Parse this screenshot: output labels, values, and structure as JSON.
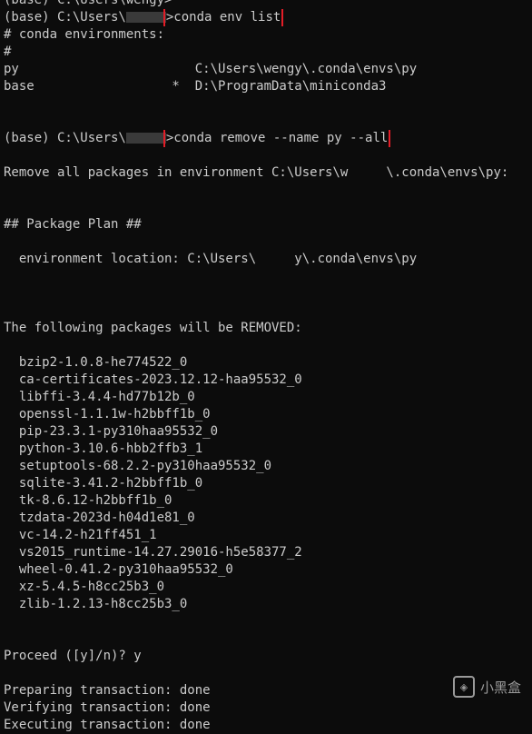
{
  "terminal": {
    "lines": [
      {
        "type": "text",
        "text": "(base) C:\\Users\\wengy>"
      },
      {
        "type": "prompt",
        "prefix": "(base) C:\\Users\\",
        "suffix": ">",
        "command": "conda env list",
        "boxed": true
      },
      {
        "type": "text",
        "text": "# conda environments:"
      },
      {
        "type": "text",
        "text": "#"
      },
      {
        "type": "text",
        "text": "py                       C:\\Users\\wengy\\.conda\\envs\\py"
      },
      {
        "type": "text",
        "text": "base                  *  D:\\ProgramData\\miniconda3"
      },
      {
        "type": "blank"
      },
      {
        "type": "blank"
      },
      {
        "type": "prompt",
        "prefix": "(base) C:\\Users\\",
        "suffix": ">",
        "command": "conda remove --name py --all",
        "boxed": true
      },
      {
        "type": "blank"
      },
      {
        "type": "text",
        "text": "Remove all packages in environment C:\\Users\\w     \\.conda\\envs\\py:"
      },
      {
        "type": "blank"
      },
      {
        "type": "blank"
      },
      {
        "type": "text",
        "text": "## Package Plan ##"
      },
      {
        "type": "blank"
      },
      {
        "type": "text",
        "text": "  environment location: C:\\Users\\     y\\.conda\\envs\\py"
      },
      {
        "type": "blank"
      },
      {
        "type": "blank"
      },
      {
        "type": "blank"
      },
      {
        "type": "text",
        "text": "The following packages will be REMOVED:"
      },
      {
        "type": "blank"
      },
      {
        "type": "text",
        "text": "  bzip2-1.0.8-he774522_0"
      },
      {
        "type": "text",
        "text": "  ca-certificates-2023.12.12-haa95532_0"
      },
      {
        "type": "text",
        "text": "  libffi-3.4.4-hd77b12b_0"
      },
      {
        "type": "text",
        "text": "  openssl-1.1.1w-h2bbff1b_0"
      },
      {
        "type": "text",
        "text": "  pip-23.3.1-py310haa95532_0"
      },
      {
        "type": "text",
        "text": "  python-3.10.6-hbb2ffb3_1"
      },
      {
        "type": "text",
        "text": "  setuptools-68.2.2-py310haa95532_0"
      },
      {
        "type": "text",
        "text": "  sqlite-3.41.2-h2bbff1b_0"
      },
      {
        "type": "text",
        "text": "  tk-8.6.12-h2bbff1b_0"
      },
      {
        "type": "text",
        "text": "  tzdata-2023d-h04d1e81_0"
      },
      {
        "type": "text",
        "text": "  vc-14.2-h21ff451_1"
      },
      {
        "type": "text",
        "text": "  vs2015_runtime-14.27.29016-h5e58377_2"
      },
      {
        "type": "text",
        "text": "  wheel-0.41.2-py310haa95532_0"
      },
      {
        "type": "text",
        "text": "  xz-5.4.5-h8cc25b3_0"
      },
      {
        "type": "text",
        "text": "  zlib-1.2.13-h8cc25b3_0"
      },
      {
        "type": "blank"
      },
      {
        "type": "blank"
      },
      {
        "type": "text",
        "text": "Proceed ([y]/n)? y"
      },
      {
        "type": "blank"
      },
      {
        "type": "text",
        "text": "Preparing transaction: done"
      },
      {
        "type": "text",
        "text": "Verifying transaction: done"
      },
      {
        "type": "text",
        "text": "Executing transaction: done"
      }
    ]
  },
  "watermark": {
    "icon": "heybox-logo-icon",
    "label": "小黑盒"
  },
  "colors": {
    "background": "#0c0c0c",
    "text": "#cccccc",
    "highlight_box": "#e31d27"
  }
}
